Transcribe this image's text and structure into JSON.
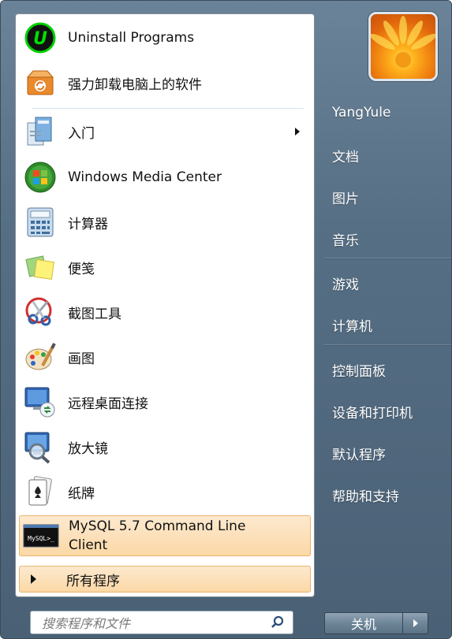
{
  "left_items": [
    {
      "label": "Uninstall Programs",
      "icon": "iobit-uninstaller-icon"
    },
    {
      "label": "强力卸载电脑上的软件",
      "icon": "recycle-box-icon"
    },
    {
      "label": "入门",
      "icon": "getting-started-icon"
    },
    {
      "label": "Windows Media Center",
      "icon": "windows-media-center-icon"
    },
    {
      "label": "计算器",
      "icon": "calculator-icon"
    },
    {
      "label": "便笺",
      "icon": "sticky-notes-icon"
    },
    {
      "label": "截图工具",
      "icon": "snipping-tool-icon"
    },
    {
      "label": "画图",
      "icon": "paint-palette-icon"
    },
    {
      "label": "远程桌面连接",
      "icon": "remote-desktop-icon"
    },
    {
      "label": "放大镜",
      "icon": "magnifier-icon"
    },
    {
      "label": "纸牌",
      "icon": "solitaire-card-icon"
    },
    {
      "label": "MySQL 5.7 Command Line Client",
      "icon": "mysql-console-icon"
    }
  ],
  "mysql_icon_text": "MySQL>_",
  "all_programs": "所有程序",
  "search": {
    "placeholder": "搜索程序和文件"
  },
  "right_items": [
    {
      "label": "YangYule"
    },
    {
      "label": "文档"
    },
    {
      "label": "图片"
    },
    {
      "label": "音乐"
    },
    {
      "label": "游戏"
    },
    {
      "label": "计算机"
    },
    {
      "label": "控制面板"
    },
    {
      "label": "设备和打印机"
    },
    {
      "label": "默认程序"
    },
    {
      "label": "帮助和支持"
    }
  ],
  "shutdown": {
    "label": "关机"
  },
  "colors": {
    "highlight": "#fbd8a6",
    "right_pane": "#566f85",
    "accent_green": "#00e000"
  }
}
